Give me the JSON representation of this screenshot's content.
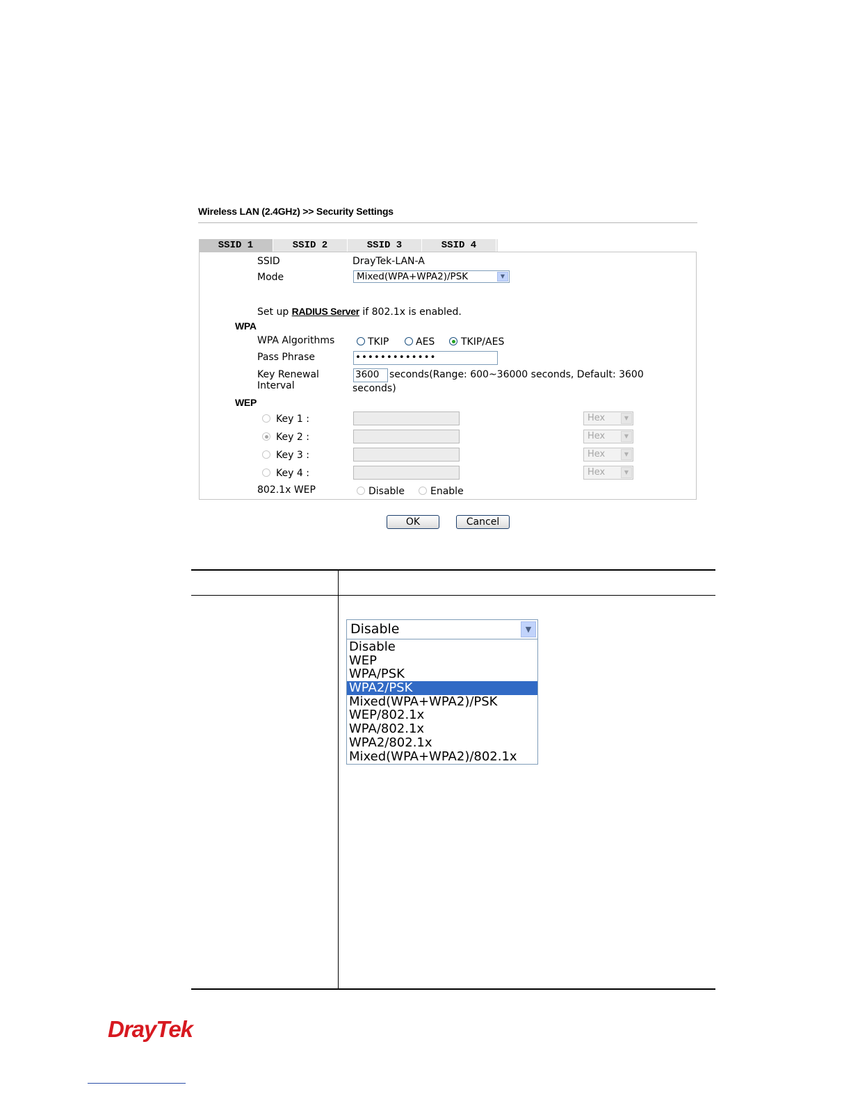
{
  "breadcrumb": "Wireless LAN (2.4GHz) >> Security Settings",
  "tabs": [
    "SSID 1",
    "SSID 2",
    "SSID 3",
    "SSID 4"
  ],
  "ssid": {
    "label": "SSID",
    "value": "DrayTek-LAN-A"
  },
  "mode": {
    "label": "Mode",
    "value": "Mixed(WPA+WPA2)/PSK"
  },
  "radius": {
    "prefix": "Set up ",
    "link": "RADIUS Server",
    "suffix": " if 802.1x is enabled."
  },
  "wpa": {
    "heading": "WPA",
    "algorithms_label": "WPA Algorithms",
    "algorithms": [
      "TKIP",
      "AES",
      "TKIP/AES"
    ],
    "selected_algorithm": "TKIP/AES",
    "pass_phrase_label": "Pass Phrase",
    "pass_phrase_value": "•••••••••••••",
    "key_renewal_label_1": "Key Renewal",
    "key_renewal_label_2": "Interval",
    "key_renewal_value": "3600",
    "key_renewal_note_1": "seconds(Range: 600~36000 seconds, Default: 3600",
    "key_renewal_note_2": "seconds)"
  },
  "wep": {
    "heading": "WEP",
    "keys": [
      "Key 1 :",
      "Key 2 :",
      "Key 3 :",
      "Key 4 :"
    ],
    "selected_key": "Key 2 :",
    "format": "Hex",
    "dot1x_label": "802.1x WEP",
    "dot1x_options": [
      "Disable",
      "Enable"
    ]
  },
  "buttons": {
    "ok": "OK",
    "cancel": "Cancel"
  },
  "mode_dropdown": {
    "selected": "Disable",
    "highlighted": "WPA2/PSK",
    "options": [
      "Disable",
      "WEP",
      "WPA/PSK",
      "WPA2/PSK",
      "Mixed(WPA+WPA2)/PSK",
      "WEP/802.1x",
      "WPA/802.1x",
      "WPA2/802.1x",
      "Mixed(WPA+WPA2)/802.1x"
    ]
  },
  "logo": "DrayTek",
  "colors": {
    "brand_red": "#d71920",
    "highlight_blue": "#316ac5",
    "radio_green": "#21a121"
  }
}
